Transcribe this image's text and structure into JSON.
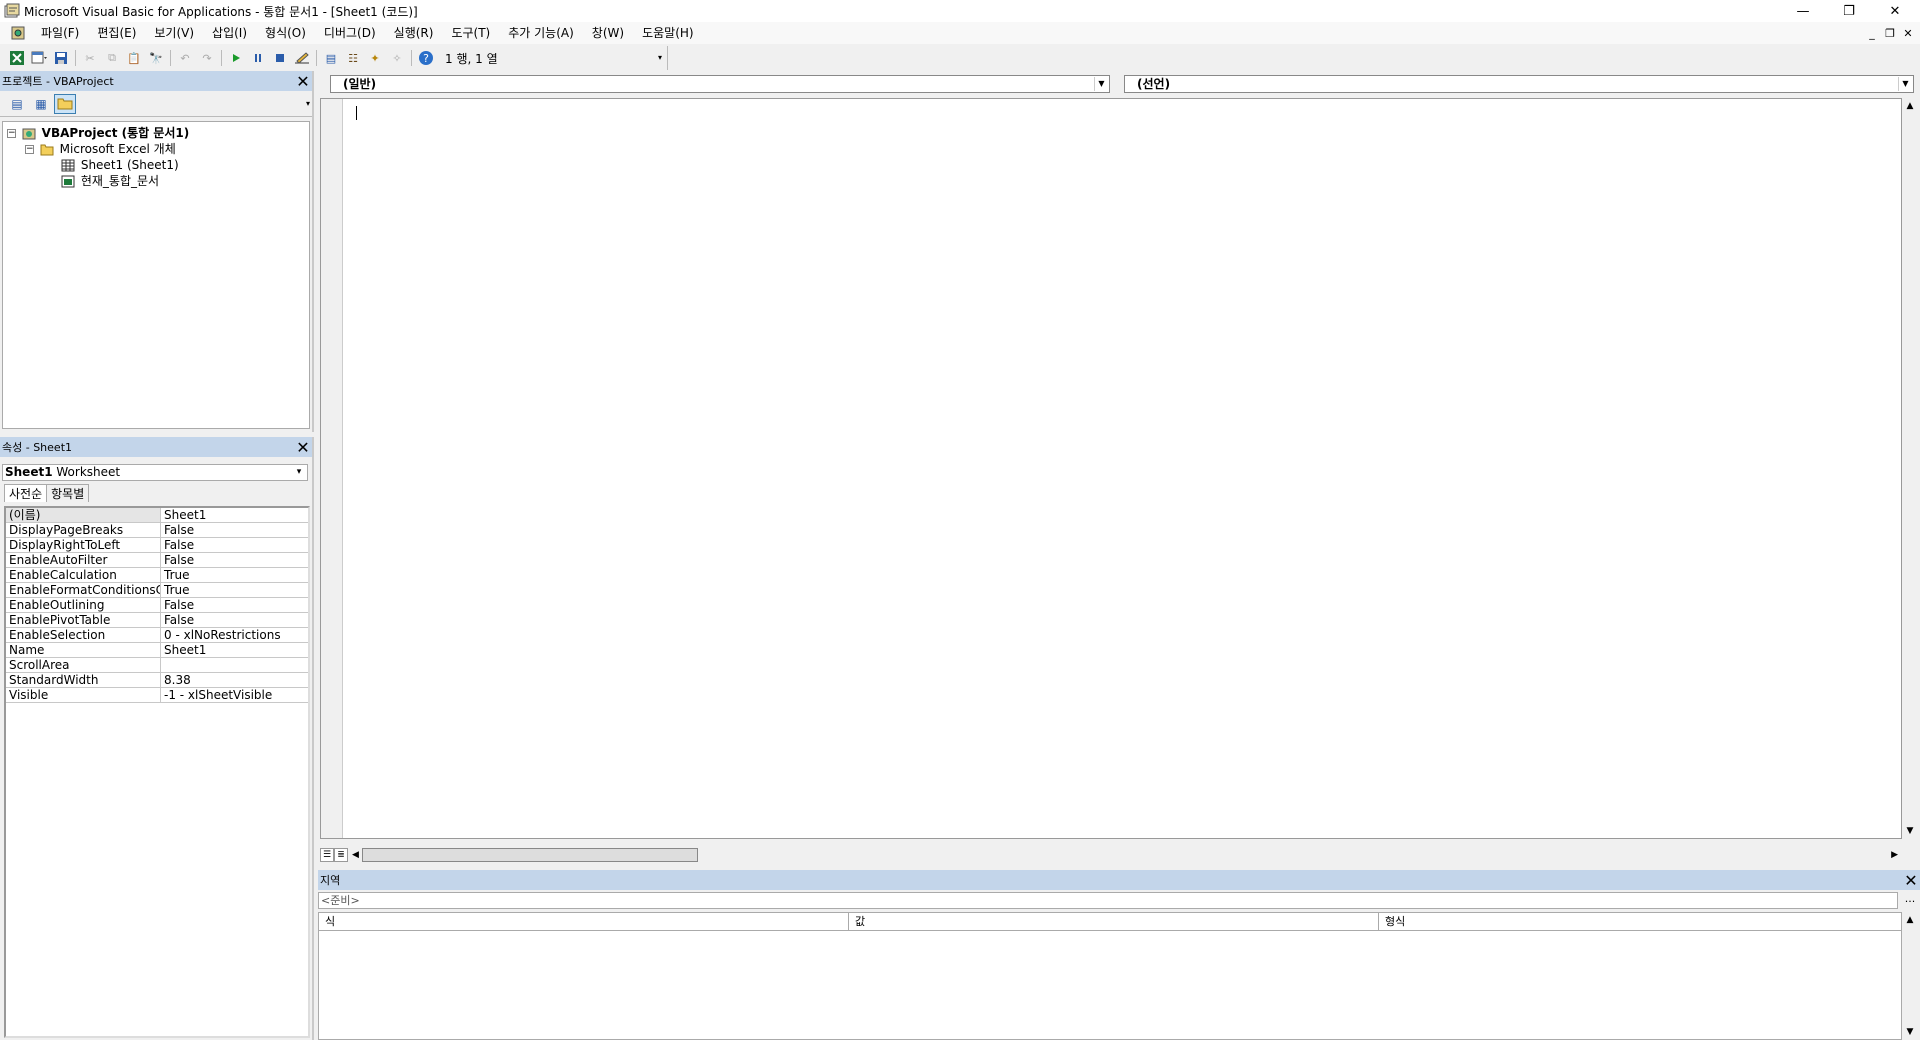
{
  "titlebar": {
    "title": "Microsoft Visual Basic for Applications - 통합 문서1 - [Sheet1 (코드)]",
    "minimize": "—",
    "restore": "❐",
    "close": "✕"
  },
  "menubar": {
    "items": [
      "파일(F)",
      "편집(E)",
      "보기(V)",
      "삽입(I)",
      "형식(O)",
      "디버그(D)",
      "실행(R)",
      "도구(T)",
      "추가 기능(A)",
      "창(W)",
      "도움말(H)"
    ],
    "mdi_minimize": "_",
    "mdi_restore": "❐",
    "mdi_close": "✕"
  },
  "toolbar": {
    "cursor_position": "1 행, 1 열"
  },
  "project_pane": {
    "title": "프로젝트 - VBAProject",
    "close": "✕",
    "tree": {
      "root": "VBAProject (통합 문서1)",
      "folder": "Microsoft Excel 개체",
      "items": [
        "Sheet1 (Sheet1)",
        "현재_통합_문서"
      ]
    }
  },
  "properties_pane": {
    "title": "속성 - Sheet1",
    "close": "✕",
    "object_name": "Sheet1",
    "object_type": "Worksheet",
    "tabs": [
      "사전순",
      "항목별"
    ],
    "rows": [
      {
        "name": "(이름)",
        "value": "Sheet1"
      },
      {
        "name": "DisplayPageBreaks",
        "value": "False"
      },
      {
        "name": "DisplayRightToLeft",
        "value": "False"
      },
      {
        "name": "EnableAutoFilter",
        "value": "False"
      },
      {
        "name": "EnableCalculation",
        "value": "True"
      },
      {
        "name": "EnableFormatConditionsCa",
        "value": "True"
      },
      {
        "name": "EnableOutlining",
        "value": "False"
      },
      {
        "name": "EnablePivotTable",
        "value": "False"
      },
      {
        "name": "EnableSelection",
        "value": "0 - xlNoRestrictions"
      },
      {
        "name": "Name",
        "value": "Sheet1"
      },
      {
        "name": "ScrollArea",
        "value": ""
      },
      {
        "name": "StandardWidth",
        "value": "8.38"
      },
      {
        "name": "Visible",
        "value": "-1 - xlSheetVisible"
      }
    ]
  },
  "code_window": {
    "object_combo": "(일반)",
    "procedure_combo": "(선언)"
  },
  "locals_window": {
    "title": "지역",
    "close": "✕",
    "context": "<준비>",
    "context_button": "...",
    "columns": [
      "식",
      "값",
      "형식"
    ]
  },
  "colors": {
    "pane_header": "#c3d5ea",
    "background": "#f0f0f0",
    "selection": "#cce4f7"
  }
}
